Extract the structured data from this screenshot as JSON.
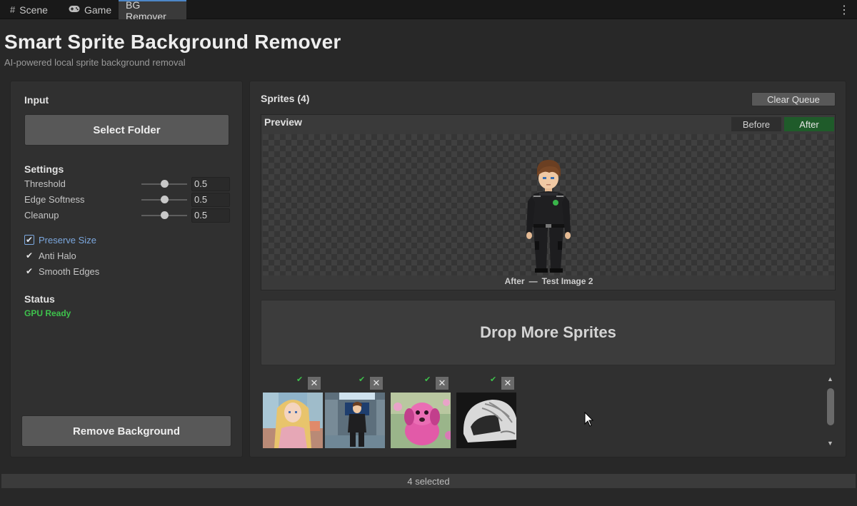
{
  "tabs": [
    {
      "icon": "grid-icon",
      "label": "Scene"
    },
    {
      "icon": "gamepad-icon",
      "label": "Game"
    },
    {
      "icon": "",
      "label": "BG Remover"
    }
  ],
  "header": {
    "title": "Smart Sprite Background Remover",
    "subtitle": "AI-powered local sprite background removal"
  },
  "input": {
    "label": "Input",
    "select_folder": "Select Folder"
  },
  "settings": {
    "label": "Settings",
    "sliders": [
      {
        "label": "Threshold",
        "value": "0.5",
        "level": 0.5
      },
      {
        "label": "Edge Softness",
        "value": "0.5",
        "level": 0.5
      },
      {
        "label": "Cleanup",
        "value": "0.5",
        "level": 0.5
      }
    ],
    "checkboxes": [
      {
        "label": "Preserve Size",
        "checked": true,
        "focused": true
      },
      {
        "label": "Anti Halo",
        "checked": true
      },
      {
        "label": "Smooth Edges",
        "checked": true
      }
    ]
  },
  "status": {
    "label": "Status",
    "value": "GPU Ready",
    "color": "#3ec24c"
  },
  "actions": {
    "remove_background": "Remove Background",
    "clear_queue": "Clear Queue"
  },
  "sprites": {
    "title": "Sprites (4)",
    "preview": {
      "label": "Preview",
      "before": "Before",
      "after": "After",
      "active": "After",
      "caption_mode": "After",
      "caption_sep": "—",
      "caption_name": "Test Image 2"
    },
    "dropzone": "Drop More Sprites",
    "thumbnails": [
      {
        "name": "anime-girl-thumbnail",
        "done": true
      },
      {
        "name": "space-pilot-thumbnail",
        "done": true
      },
      {
        "name": "pink-puppy-thumbnail",
        "done": true
      },
      {
        "name": "helmet-thumbnail",
        "done": true
      }
    ],
    "remove_glyph": "✕",
    "done_glyph": "✔"
  },
  "statusbar": {
    "text": "4 selected"
  },
  "colors": {
    "accent_green": "#1f5b2a",
    "focus_blue": "#7ba7de",
    "ready_green": "#3ec24c"
  }
}
